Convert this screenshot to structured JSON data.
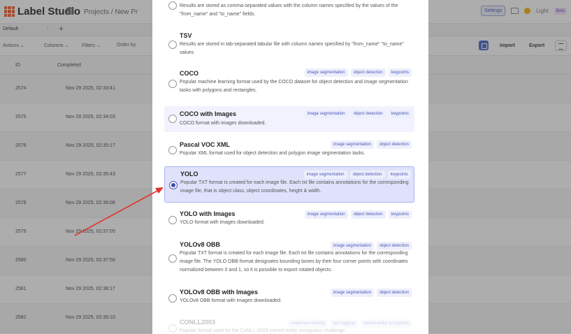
{
  "app": {
    "name": "Label Studio",
    "breadcrumb": "Projects / New Pr",
    "settings_label": "Settings",
    "theme_label": "Light",
    "beta_label": "Beta"
  },
  "tabs": {
    "default_label": "Default",
    "menu_glyph": "⋮",
    "add_glyph": "+"
  },
  "toolbar": {
    "actions_label": "Actions ⌄",
    "columns_label": "Columns ⌄",
    "filters_label": "Filters ⌄",
    "order_label": "Order by",
    "import_label": "Import",
    "export_label": "Export"
  },
  "table": {
    "headers": {
      "id": "ID",
      "completed": "Completed"
    },
    "rows": [
      {
        "id": "2574",
        "completed": "Nov 29 2025, 02:33:41"
      },
      {
        "id": "2575",
        "completed": "Nov 29 2025, 02:34:03"
      },
      {
        "id": "2576",
        "completed": "Nov 29 2025, 02:35:17"
      },
      {
        "id": "2577",
        "completed": "Nov 29 2025, 02:35:43"
      },
      {
        "id": "2578",
        "completed": "Nov 29 2025, 02:36:08"
      },
      {
        "id": "2579",
        "completed": "Nov 29 2025, 02:37:05"
      },
      {
        "id": "2580",
        "completed": "Nov 29 2025, 02:37:56"
      },
      {
        "id": "2581",
        "completed": "Nov 29 2025, 02:38:17"
      },
      {
        "id": "2582",
        "completed": "Nov 29 2025, 02:39:10"
      }
    ]
  },
  "export_dialog": {
    "formats": [
      {
        "title": "",
        "desc": "Results are stored as comma-separated values with the column names specified by the values of the \"from_name\" and \"to_name\" fields.",
        "tags": [],
        "selected": false
      },
      {
        "title": "TSV",
        "desc": "Results are stored in tab-separated tabular file with column names specified by \"from_name\" \"to_name\" values",
        "tags": [],
        "selected": false
      },
      {
        "title": "COCO",
        "desc": "Popular machine learning format used by the COCO dataset for object detection and image segmentation tasks with polygons and rectangles.",
        "tags": [
          "image segmentation",
          "object detection",
          "keypoints"
        ],
        "selected": false
      },
      {
        "title": "COCO with Images",
        "desc": "COCO format with images downloaded.",
        "tags": [
          "image segmentation",
          "object detection",
          "keypoints"
        ],
        "selected": false
      },
      {
        "title": "Pascal VOC XML",
        "desc": "Popular XML format used for object detection and polygon image segmentation tasks.",
        "tags": [
          "image segmentation",
          "object detection"
        ],
        "selected": false
      },
      {
        "title": "YOLO",
        "desc": "Popular TXT format is created for each image file. Each txt file contains annotations for the corresponding image file, that is object class, object coordinates, height & width.",
        "tags": [
          "image segmentation",
          "object detection",
          "keypoints"
        ],
        "selected": true
      },
      {
        "title": "YOLO with Images",
        "desc": "YOLO format with images downloaded.",
        "tags": [
          "image segmentation",
          "object detection",
          "keypoints"
        ],
        "selected": false
      },
      {
        "title": "YOLOv8 OBB",
        "desc": "Popular TXT format is created for each image file. Each txt file contains annotations for the corresponding image file. The YOLO OBB format designates bounding boxes by their four corner points with coordinates normalized between 0 and 1, so it is possible to export rotated objects.",
        "tags": [
          "image segmentation",
          "object detection"
        ],
        "selected": false
      },
      {
        "title": "YOLOv8 OBB with Images",
        "desc": "YOLOv8 OBB format with images downloaded.",
        "tags": [
          "image segmentation",
          "object detection"
        ],
        "selected": false
      },
      {
        "title": "CONLL2003",
        "desc": "Popular format used for the CoNLL-2003 named entity recognition challenge.",
        "tags": [
          "sequence labeling",
          "text tagging",
          "named entity recognition"
        ],
        "selected": false
      }
    ]
  },
  "colors": {
    "accent": "#4a5ab8",
    "selected_bg": "#dfe2fa",
    "annotation_arrow": "#e0352b",
    "logo": "#f25c2c"
  }
}
